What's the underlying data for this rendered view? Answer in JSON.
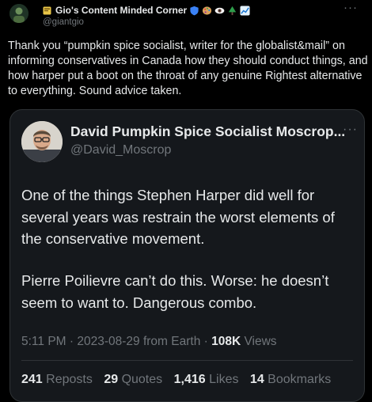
{
  "post": {
    "author": {
      "display_name": "Gio's Content Minded Corner",
      "handle": "@giantgio",
      "name_emojis": [
        "shield-icon",
        "palette-icon",
        "eye-icon",
        "tree-icon",
        "chart-icon"
      ]
    },
    "body": "Thank you “pumpkin spice socialist, writer for the globalist&mail” on informing conservatives in Canada how they should conduct things, and how harper put a boot on the throat of any genuine Rightest alternative to everything. Sound advice taken.",
    "more_label": "···"
  },
  "quoted": {
    "author": {
      "display_name": "David Pumpkin Spice Socialist Moscrop...",
      "handle": "@David_Moscrop"
    },
    "more_label": "···",
    "paragraphs": [
      "One of the things Stephen Harper did well for several years was restrain the worst elements of the conservative movement.",
      "Pierre Poilievre can’t do this. Worse: he doesn’t seem to want to. Dangerous combo."
    ],
    "meta": {
      "time": "5:11 PM",
      "date": "2023-08-29",
      "source": "from Earth",
      "views_count": "108K",
      "views_label": "Views"
    },
    "stats": {
      "reposts_count": "241",
      "reposts_label": "Reposts",
      "quotes_count": "29",
      "quotes_label": "Quotes",
      "likes_count": "1,416",
      "likes_label": "Likes",
      "bookmarks_count": "14",
      "bookmarks_label": "Bookmarks"
    }
  },
  "colors": {
    "background": "#000000",
    "card_background": "#15181c",
    "text_primary": "#e7e9ea",
    "text_secondary": "#71767b",
    "border": "#2f3336"
  }
}
